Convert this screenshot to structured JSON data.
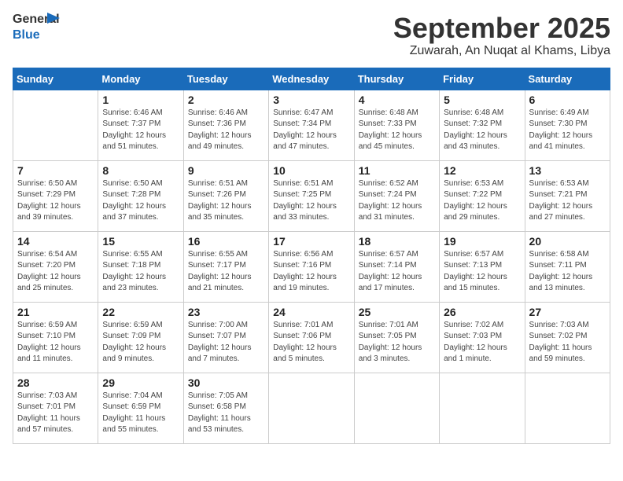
{
  "header": {
    "logo_general": "General",
    "logo_blue": "Blue",
    "month_title": "September 2025",
    "location": "Zuwarah, An Nuqat al Khams, Libya"
  },
  "columns": [
    "Sunday",
    "Monday",
    "Tuesday",
    "Wednesday",
    "Thursday",
    "Friday",
    "Saturday"
  ],
  "weeks": [
    [
      {
        "day": "",
        "sunrise": "",
        "sunset": "",
        "daylight": ""
      },
      {
        "day": "1",
        "sunrise": "Sunrise: 6:46 AM",
        "sunset": "Sunset: 7:37 PM",
        "daylight": "Daylight: 12 hours and 51 minutes."
      },
      {
        "day": "2",
        "sunrise": "Sunrise: 6:46 AM",
        "sunset": "Sunset: 7:36 PM",
        "daylight": "Daylight: 12 hours and 49 minutes."
      },
      {
        "day": "3",
        "sunrise": "Sunrise: 6:47 AM",
        "sunset": "Sunset: 7:34 PM",
        "daylight": "Daylight: 12 hours and 47 minutes."
      },
      {
        "day": "4",
        "sunrise": "Sunrise: 6:48 AM",
        "sunset": "Sunset: 7:33 PM",
        "daylight": "Daylight: 12 hours and 45 minutes."
      },
      {
        "day": "5",
        "sunrise": "Sunrise: 6:48 AM",
        "sunset": "Sunset: 7:32 PM",
        "daylight": "Daylight: 12 hours and 43 minutes."
      },
      {
        "day": "6",
        "sunrise": "Sunrise: 6:49 AM",
        "sunset": "Sunset: 7:30 PM",
        "daylight": "Daylight: 12 hours and 41 minutes."
      }
    ],
    [
      {
        "day": "7",
        "sunrise": "Sunrise: 6:50 AM",
        "sunset": "Sunset: 7:29 PM",
        "daylight": "Daylight: 12 hours and 39 minutes."
      },
      {
        "day": "8",
        "sunrise": "Sunrise: 6:50 AM",
        "sunset": "Sunset: 7:28 PM",
        "daylight": "Daylight: 12 hours and 37 minutes."
      },
      {
        "day": "9",
        "sunrise": "Sunrise: 6:51 AM",
        "sunset": "Sunset: 7:26 PM",
        "daylight": "Daylight: 12 hours and 35 minutes."
      },
      {
        "day": "10",
        "sunrise": "Sunrise: 6:51 AM",
        "sunset": "Sunset: 7:25 PM",
        "daylight": "Daylight: 12 hours and 33 minutes."
      },
      {
        "day": "11",
        "sunrise": "Sunrise: 6:52 AM",
        "sunset": "Sunset: 7:24 PM",
        "daylight": "Daylight: 12 hours and 31 minutes."
      },
      {
        "day": "12",
        "sunrise": "Sunrise: 6:53 AM",
        "sunset": "Sunset: 7:22 PM",
        "daylight": "Daylight: 12 hours and 29 minutes."
      },
      {
        "day": "13",
        "sunrise": "Sunrise: 6:53 AM",
        "sunset": "Sunset: 7:21 PM",
        "daylight": "Daylight: 12 hours and 27 minutes."
      }
    ],
    [
      {
        "day": "14",
        "sunrise": "Sunrise: 6:54 AM",
        "sunset": "Sunset: 7:20 PM",
        "daylight": "Daylight: 12 hours and 25 minutes."
      },
      {
        "day": "15",
        "sunrise": "Sunrise: 6:55 AM",
        "sunset": "Sunset: 7:18 PM",
        "daylight": "Daylight: 12 hours and 23 minutes."
      },
      {
        "day": "16",
        "sunrise": "Sunrise: 6:55 AM",
        "sunset": "Sunset: 7:17 PM",
        "daylight": "Daylight: 12 hours and 21 minutes."
      },
      {
        "day": "17",
        "sunrise": "Sunrise: 6:56 AM",
        "sunset": "Sunset: 7:16 PM",
        "daylight": "Daylight: 12 hours and 19 minutes."
      },
      {
        "day": "18",
        "sunrise": "Sunrise: 6:57 AM",
        "sunset": "Sunset: 7:14 PM",
        "daylight": "Daylight: 12 hours and 17 minutes."
      },
      {
        "day": "19",
        "sunrise": "Sunrise: 6:57 AM",
        "sunset": "Sunset: 7:13 PM",
        "daylight": "Daylight: 12 hours and 15 minutes."
      },
      {
        "day": "20",
        "sunrise": "Sunrise: 6:58 AM",
        "sunset": "Sunset: 7:11 PM",
        "daylight": "Daylight: 12 hours and 13 minutes."
      }
    ],
    [
      {
        "day": "21",
        "sunrise": "Sunrise: 6:59 AM",
        "sunset": "Sunset: 7:10 PM",
        "daylight": "Daylight: 12 hours and 11 minutes."
      },
      {
        "day": "22",
        "sunrise": "Sunrise: 6:59 AM",
        "sunset": "Sunset: 7:09 PM",
        "daylight": "Daylight: 12 hours and 9 minutes."
      },
      {
        "day": "23",
        "sunrise": "Sunrise: 7:00 AM",
        "sunset": "Sunset: 7:07 PM",
        "daylight": "Daylight: 12 hours and 7 minutes."
      },
      {
        "day": "24",
        "sunrise": "Sunrise: 7:01 AM",
        "sunset": "Sunset: 7:06 PM",
        "daylight": "Daylight: 12 hours and 5 minutes."
      },
      {
        "day": "25",
        "sunrise": "Sunrise: 7:01 AM",
        "sunset": "Sunset: 7:05 PM",
        "daylight": "Daylight: 12 hours and 3 minutes."
      },
      {
        "day": "26",
        "sunrise": "Sunrise: 7:02 AM",
        "sunset": "Sunset: 7:03 PM",
        "daylight": "Daylight: 12 hours and 1 minute."
      },
      {
        "day": "27",
        "sunrise": "Sunrise: 7:03 AM",
        "sunset": "Sunset: 7:02 PM",
        "daylight": "Daylight: 11 hours and 59 minutes."
      }
    ],
    [
      {
        "day": "28",
        "sunrise": "Sunrise: 7:03 AM",
        "sunset": "Sunset: 7:01 PM",
        "daylight": "Daylight: 11 hours and 57 minutes."
      },
      {
        "day": "29",
        "sunrise": "Sunrise: 7:04 AM",
        "sunset": "Sunset: 6:59 PM",
        "daylight": "Daylight: 11 hours and 55 minutes."
      },
      {
        "day": "30",
        "sunrise": "Sunrise: 7:05 AM",
        "sunset": "Sunset: 6:58 PM",
        "daylight": "Daylight: 11 hours and 53 minutes."
      },
      {
        "day": "",
        "sunrise": "",
        "sunset": "",
        "daylight": ""
      },
      {
        "day": "",
        "sunrise": "",
        "sunset": "",
        "daylight": ""
      },
      {
        "day": "",
        "sunrise": "",
        "sunset": "",
        "daylight": ""
      },
      {
        "day": "",
        "sunrise": "",
        "sunset": "",
        "daylight": ""
      }
    ]
  ]
}
